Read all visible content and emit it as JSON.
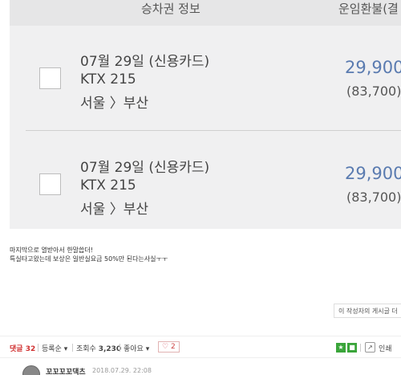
{
  "panel": {
    "header": {
      "ticket_info": "승차권 정보",
      "refund": "운임환불(결"
    },
    "tickets": [
      {
        "date": "07월 29일 (신용카드)",
        "train": "KTX 215",
        "route_from": "서울",
        "route_to": "부산",
        "price": "29,900",
        "original_price": "(83,700)"
      },
      {
        "date": "07월 29일 (신용카드)",
        "train": "KTX 215",
        "route_from": "서울",
        "route_to": "부산",
        "price": "29,900",
        "original_price": "(83,700)"
      }
    ]
  },
  "post": {
    "line1": "마지막으로 열받아서 한말씁더!",
    "line2": "특실타고왔는데 보상은 일반실요금 50%만 된다는사실ㅜㅜ",
    "author_posts": "이 작성자의 게시글 더"
  },
  "comment_bar": {
    "comment_label": "댓글",
    "comment_count": "32",
    "sort": "등록순",
    "views_label": "조회수",
    "views": "3,230",
    "likes_label": "좋아요",
    "heart_count": "2",
    "print": "인쇄"
  },
  "comment": {
    "author": "꼬꼬꼬꼬댁츠",
    "date": "2018.07.29. 22:08"
  },
  "colors": {
    "panel_bg": "#f0f0f1",
    "price_blue": "#5a7bb0",
    "comment_red": "#d03030",
    "share_green": "#3aa53a"
  }
}
